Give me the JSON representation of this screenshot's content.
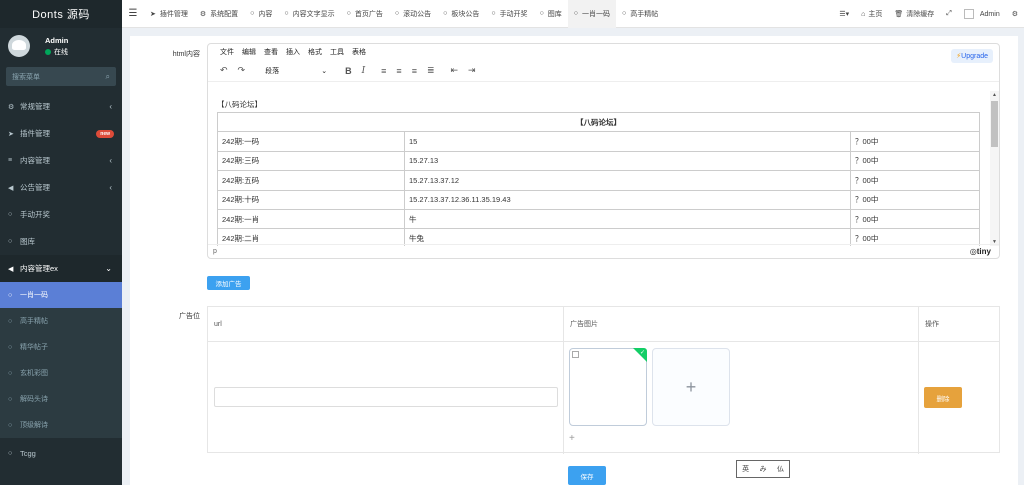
{
  "app": {
    "logo": "Donts 源码"
  },
  "user": {
    "name": "Admin",
    "status": "在线"
  },
  "sidebar": {
    "search_placeholder": "搜索菜单",
    "items": [
      {
        "label": "常规管理",
        "icon": "cogs-icon",
        "glyph": "⚙",
        "arrow": "‹"
      },
      {
        "label": "插件管理",
        "icon": "rocket-icon",
        "glyph": "➤",
        "badge": "new"
      },
      {
        "label": "内容管理",
        "icon": "list-icon",
        "glyph": "≡",
        "arrow": "‹"
      },
      {
        "label": "公告管理",
        "icon": "volume-icon",
        "glyph": "◀",
        "arrow": "‹"
      },
      {
        "label": "手动开奖",
        "icon": "circle-icon",
        "glyph": "○"
      },
      {
        "label": "图库",
        "icon": "circle-icon",
        "glyph": "○"
      },
      {
        "label": "内容管理ex",
        "icon": "volume-icon",
        "glyph": "◀",
        "arrow": "⌄"
      }
    ],
    "subitems": [
      {
        "label": "一肖一码",
        "active": true
      },
      {
        "label": "高手精帖"
      },
      {
        "label": "精华帖子"
      },
      {
        "label": "玄机彩图"
      },
      {
        "label": "解码头诗"
      },
      {
        "label": "顶级解诗"
      }
    ],
    "last_item": {
      "label": "Tcgg",
      "glyph": "○"
    }
  },
  "topbar": {
    "tabs": [
      {
        "label": "插件管理",
        "glyph": "➤",
        "icon": "rocket-icon"
      },
      {
        "label": "系统配置",
        "glyph": "⚙",
        "icon": "gear-icon"
      },
      {
        "label": "内容",
        "glyph": "○",
        "icon": "circle-icon"
      },
      {
        "label": "内容文字显示",
        "glyph": "○",
        "icon": "circle-icon"
      },
      {
        "label": "首页广告",
        "glyph": "○",
        "icon": "circle-icon"
      },
      {
        "label": "滚动公告",
        "glyph": "○",
        "icon": "circle-icon"
      },
      {
        "label": "板块公告",
        "glyph": "○",
        "icon": "circle-icon"
      },
      {
        "label": "手动开奖",
        "glyph": "○",
        "icon": "circle-icon"
      },
      {
        "label": "图库",
        "glyph": "○",
        "icon": "circle-icon"
      },
      {
        "label": "一肖一码",
        "glyph": "○",
        "icon": "circle-icon",
        "active": true
      },
      {
        "label": "高手精帖",
        "glyph": "○",
        "icon": "circle-icon"
      }
    ],
    "right": {
      "menu_glyph": "☰▾",
      "home": "主页",
      "clear_cache": "清除缓存",
      "fullscreen_glyph": "⤢",
      "admin": "Admin",
      "settings_glyph": "⚙"
    }
  },
  "form": {
    "html_label": "html内容",
    "ad_label": "广告位",
    "add_ad_button": "添加广告",
    "save_button": "保存"
  },
  "editor": {
    "menubar": [
      "文件",
      "编辑",
      "查看",
      "插入",
      "格式",
      "工具",
      "表格"
    ],
    "upgrade": "Upgrade",
    "block_format": "段落",
    "status_path": "p",
    "brand": "tiny",
    "paragraph": "【八码论坛】",
    "table_title": "【八码论坛】",
    "rows": [
      [
        "242期:一码",
        "15",
        "？00中"
      ],
      [
        "242期:三码",
        "15.27.13",
        "？00中"
      ],
      [
        "242期:五码",
        "15.27.13.37.12",
        "？00中"
      ],
      [
        "242期:十码",
        "15.27.13.37.12.36.11.35.19.43",
        "？00中"
      ],
      [
        "242期:一肖",
        "牛",
        "？00中"
      ],
      [
        "242期:二肖",
        "牛兔",
        "？00中"
      ]
    ]
  },
  "ad_table": {
    "headers": [
      "url",
      "广告图片",
      "操作"
    ],
    "url_value": "",
    "delete_button": "删除",
    "small_plus": "+"
  },
  "stamp": {
    "chars": [
      "英",
      "み",
      "仏"
    ]
  }
}
